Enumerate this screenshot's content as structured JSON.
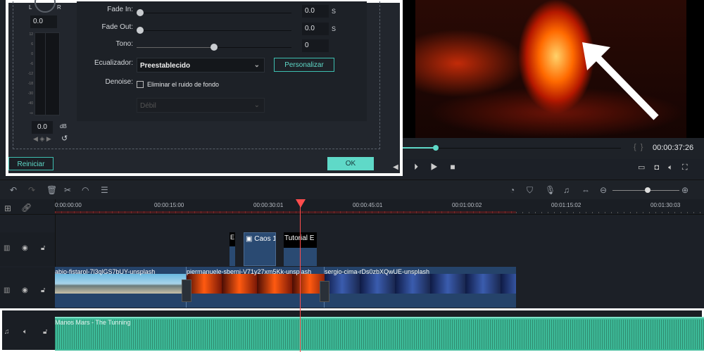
{
  "dialog": {
    "balance_l": "L",
    "balance_r": "R",
    "balance_value": "0.0",
    "volume_value": "0.0",
    "volume_unit": "dB",
    "meter_scale": [
      "12",
      "6",
      "0",
      "-6",
      "-12",
      "-18",
      "-30",
      "-40",
      "-∞"
    ],
    "fade_in_label": "Fade In:",
    "fade_in_value": "0.0",
    "fade_in_unit": "S",
    "fade_out_label": "Fade Out:",
    "fade_out_value": "0.0",
    "fade_out_unit": "S",
    "pitch_label": "Tono:",
    "pitch_value": "0",
    "pitch_fraction": 0.5,
    "eq_label": "Ecualizador:",
    "eq_value": "Preestablecido",
    "customize_label": "Personalizar",
    "denoise_label": "Denoise:",
    "denoise_checkbox": "Eliminar el ruido de fondo",
    "denoise_checked": false,
    "denoise_level": "Débil",
    "reset_label": "Reiniciar",
    "ok_label": "OK"
  },
  "player": {
    "timecode": "00:00:37:26",
    "progress": 0.15,
    "accent": "#5fd9c8"
  },
  "timeline": {
    "ruler": [
      "0:00:00:00",
      "00:00:15:00",
      "00:00:30:01",
      "00:00:45:01",
      "00:01:00:02",
      "00:01:15:02",
      "00:01:30:03"
    ],
    "title_clips": [
      "E",
      "Caos 1",
      "Tutorial E"
    ],
    "video_clips": [
      "abio-fistarol-7l3qlGS7bUY-unsplash",
      "piermanuele-sberni-V71y27xm5Kk-unsplash",
      "sergio-cima-rDs0zbXQwUE-unsplash"
    ],
    "audio_clip": "Manos Mars - The Tunning",
    "playhead_color": "#ff4d4d",
    "audio_color": "#3dbb99"
  }
}
